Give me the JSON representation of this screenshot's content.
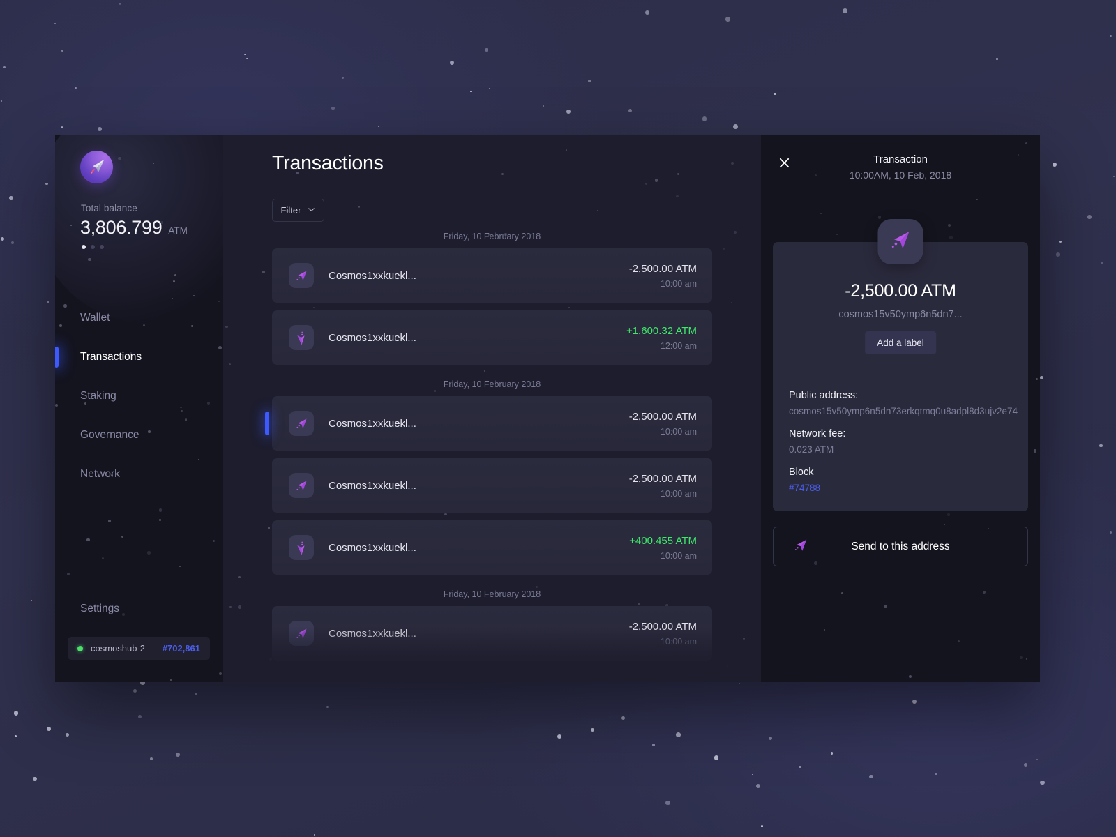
{
  "app": {
    "logo_icon": "paper-plane-logo-icon"
  },
  "sidebar": {
    "balance_label": "Total balance",
    "balance_value": "3,806.799",
    "balance_unit": "ATM",
    "carousel_dots": 3,
    "carousel_active_index": 0,
    "items": [
      {
        "label": "Wallet",
        "active": false
      },
      {
        "label": "Transactions",
        "active": true
      },
      {
        "label": "Staking",
        "active": false
      },
      {
        "label": "Governance",
        "active": false
      },
      {
        "label": "Network",
        "active": false
      }
    ],
    "settings_label": "Settings",
    "chain": {
      "status_color": "#4ce06a",
      "name": "cosmoshub-2",
      "block": "#702,861"
    }
  },
  "main": {
    "title": "Transactions",
    "filter_label": "Filter",
    "groups": [
      {
        "date": "Friday, 10 February 2018",
        "rows": [
          {
            "icon": "send-icon",
            "address": "Cosmos1xxkuekl...",
            "amount": "-2,500.00 ATM",
            "positive": false,
            "time": "10:00 am",
            "selected": false
          },
          {
            "icon": "receive-icon",
            "address": "Cosmos1xxkuekl...",
            "amount": "+1,600.32 ATM",
            "positive": true,
            "time": "12:00 am",
            "selected": false
          }
        ]
      },
      {
        "date": "Friday, 10 February 2018",
        "rows": [
          {
            "icon": "send-icon",
            "address": "Cosmos1xxkuekl...",
            "amount": "-2,500.00 ATM",
            "positive": false,
            "time": "10:00 am",
            "selected": true
          },
          {
            "icon": "send-icon",
            "address": "Cosmos1xxkuekl...",
            "amount": "-2,500.00 ATM",
            "positive": false,
            "time": "10:00 am",
            "selected": false
          },
          {
            "icon": "receive-icon",
            "address": "Cosmos1xxkuekl...",
            "amount": "+400.455 ATM",
            "positive": true,
            "time": "10:00 am",
            "selected": false
          }
        ]
      },
      {
        "date": "Friday, 10 February 2018",
        "rows": [
          {
            "icon": "send-icon",
            "address": "Cosmos1xxkuekl...",
            "amount": "-2,500.00 ATM",
            "positive": false,
            "time": "10:00 am",
            "selected": false
          }
        ]
      }
    ]
  },
  "detail": {
    "close_icon": "close-icon",
    "title": "Transaction",
    "subtitle": "10:00AM, 10 Feb, 2018",
    "avatar_icon": "send-icon",
    "amount": "-2,500.00 ATM",
    "address_short": "cosmos15v50ymp6n5dn7...",
    "add_label_button": "Add a label",
    "fields": [
      {
        "label": "Public address:",
        "value": "cosmos15v50ymp6n5dn73erkqtmq0u8adpl8d3ujv2e74",
        "link": false
      },
      {
        "label": "Network fee:",
        "value": "0.023 ATM",
        "link": false
      },
      {
        "label": "Block",
        "value": "#74788",
        "link": true
      }
    ],
    "send_button_label": "Send to this address",
    "send_button_icon": "send-icon"
  },
  "colors": {
    "accent_blue": "#3d5afe",
    "positive_green": "#3ee86a",
    "link_blue": "#4b5de8",
    "icon_purple": "#b657e8",
    "status_green": "#4ce06a"
  }
}
